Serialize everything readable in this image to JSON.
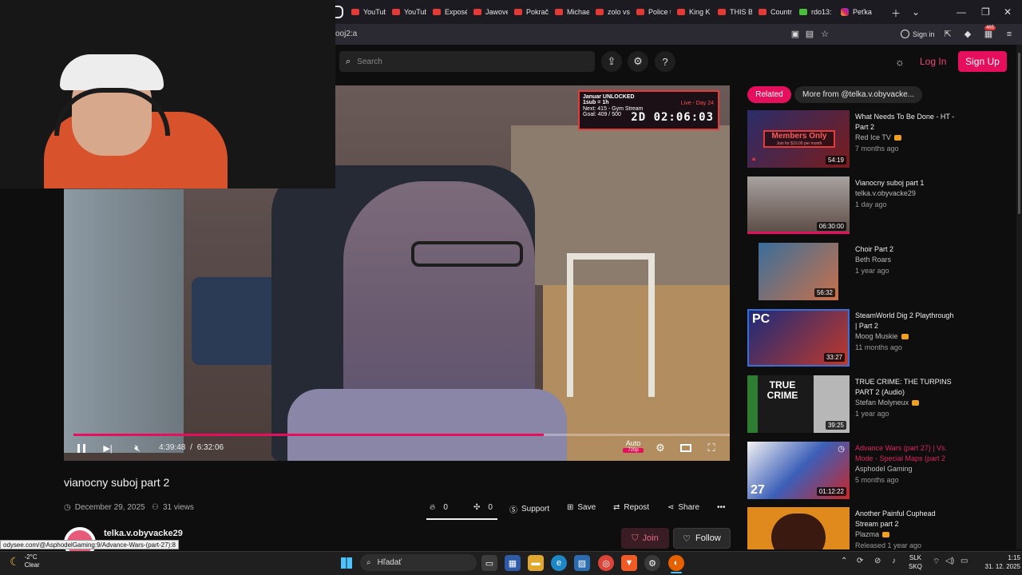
{
  "browser": {
    "tabs": [
      {
        "label": "YouTub",
        "icon": "youtube-icon"
      },
      {
        "label": "YouTub",
        "icon": "youtube-icon"
      },
      {
        "label": "Exposé",
        "icon": "youtube-icon"
      },
      {
        "label": "Jawove",
        "icon": "youtube-icon"
      },
      {
        "label": "Pokrač",
        "icon": "youtube-icon"
      },
      {
        "label": "Michae",
        "icon": "youtube-icon"
      },
      {
        "label": "zolo vs",
        "icon": "youtube-icon"
      },
      {
        "label": "Police t",
        "icon": "youtube-icon"
      },
      {
        "label": "King K",
        "icon": "youtube-icon"
      },
      {
        "label": "THIS B",
        "icon": "youtube-icon"
      },
      {
        "label": "Countr",
        "icon": "youtube-icon"
      },
      {
        "label": "rdo13:",
        "icon": "kick-icon"
      },
      {
        "label": "Peťka",
        "icon": "instagram-icon"
      }
    ],
    "url": "ooj2:a",
    "sign_in": "Sign in",
    "badge_count": "465"
  },
  "header": {
    "search_placeholder": "Search",
    "login": "Log In",
    "signup": "Sign Up"
  },
  "player": {
    "overlay": {
      "line1": "Januar UNLOCKED",
      "line2": "1sub = 1h",
      "line3": "Next: 415 - Gym Stream",
      "line4": "Goal: 409 / 500",
      "live": "Live - Day 24",
      "timer": "2D 02:06:03"
    },
    "time_current": "4:39:48",
    "time_sep": "/",
    "time_total": "6:32:06",
    "quality_label": "Auto",
    "quality_value": "720p",
    "progress": 0.717
  },
  "video": {
    "title": "vianocny suboj part 2",
    "date": "December 29, 2025",
    "views": "31 views",
    "fire_count": "0",
    "slime_count": "0",
    "support": "Support",
    "save": "Save",
    "repost": "Repost",
    "share": "Share",
    "more": "•••"
  },
  "channel": {
    "name": "telka.v.obyvacke29",
    "join": "Join",
    "follow": "Follow"
  },
  "status_url": "odysee.com/@AsphodelGaming:9/Advance-Wars-(part-27):8",
  "sidebar": {
    "tab_related": "Related",
    "tab_more": "More from @telka.v.obyvacke...",
    "items": [
      {
        "title": "What Needs To Be Done - HT - Part 2",
        "channel": "Red Ice TV",
        "age": "7 months ago",
        "duration": "54:19",
        "members_only": "Members Only",
        "members_sub": "Join for $10.00 per month"
      },
      {
        "title": "Vianocny suboj part 1",
        "channel": "telka.v.obyvacke29",
        "age": "1 day ago",
        "duration": "06:30:00"
      },
      {
        "title": "Choir Part 2",
        "channel": "Beth Roars",
        "age": "1 year ago",
        "duration": "56:32"
      },
      {
        "title": "SteamWorld Dig 2 Playthrough | Part 2",
        "channel": "Moog Muskie",
        "age": "11 months ago",
        "duration": "33:27",
        "thumb_text": "PC"
      },
      {
        "title": "TRUE CRIME: THE TURPINS PART 2 (Audio)",
        "channel": "Stefan Molyneux",
        "age": "1 year ago",
        "duration": "39:25",
        "thumb_text": "TRUE CRIME"
      },
      {
        "title": "Advance Wars (part 27) | Vs. Mode - Special Maps (part 2",
        "channel": "Asphodel Gaming",
        "age": "5 months ago",
        "duration": "01:12:22",
        "thumb_text": "27"
      },
      {
        "title": "Another Painful Cuphead Stream part 2",
        "channel": "Plazma",
        "age": "Released 1 year ago",
        "duration": ""
      }
    ]
  },
  "taskbar": {
    "weather_temp": "-2°C",
    "weather_desc": "Clear",
    "search": "Hľadať",
    "lang1": "SLK",
    "lang2": "SKQ",
    "time": "1:15",
    "date": "31. 12. 2025"
  }
}
